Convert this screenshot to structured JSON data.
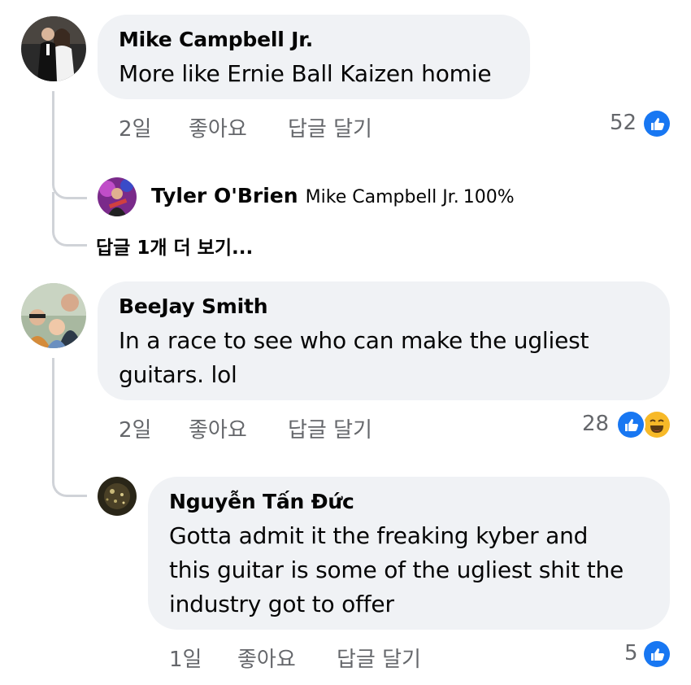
{
  "comments": [
    {
      "author": "Mike Campbell Jr.",
      "text": "More like Ernie Ball Kaizen homie",
      "time": "2일",
      "like_action": "좋아요",
      "reply_action": "답글 달기",
      "reaction_count": "52",
      "reactions": [
        "like-icon"
      ],
      "replies": [
        {
          "author": "Tyler O'Brien",
          "mention": "Mike Campbell Jr.",
          "text": "100%"
        }
      ],
      "more_replies": "답글 1개 더 보기..."
    },
    {
      "author": "BeeJay Smith",
      "text_lines": [
        "In a race to see who can make the ugliest",
        "guitars.  lol"
      ],
      "time": "2일",
      "like_action": "좋아요",
      "reply_action": "답글 달기",
      "reaction_count": "28",
      "reactions": [
        "like-icon",
        "haha-icon"
      ],
      "replies": [
        {
          "author": "Nguyễn Tấn Đức",
          "text_lines": [
            "Gotta admit it the freaking kyber and",
            "this guitar is some of the ugliest shit the",
            "industry got to offer"
          ],
          "time": "1일",
          "like_action": "좋아요",
          "reply_action": "답글 달기",
          "reaction_count": "5",
          "reactions": [
            "like-icon"
          ]
        }
      ]
    }
  ],
  "colors": {
    "bubble": "#f0f2f5",
    "meta": "#65676b",
    "like_blue": "#1877f2",
    "haha_yellow": "#f7b928",
    "thread_line": "#d0d3d8"
  }
}
